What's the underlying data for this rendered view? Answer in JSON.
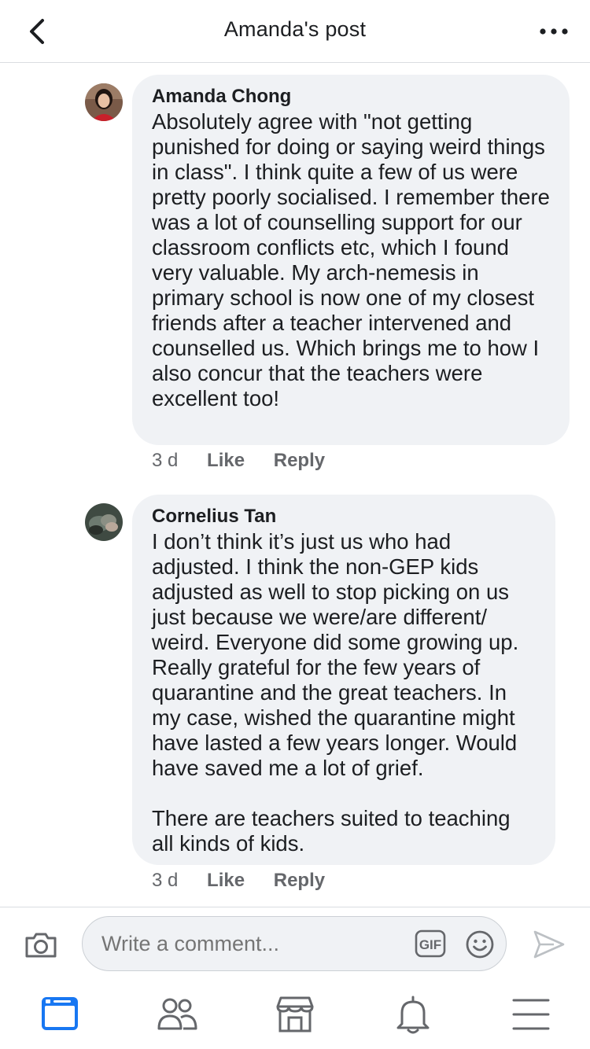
{
  "header": {
    "title": "Amanda's post",
    "back_icon": "chevron-left-icon",
    "more_icon": "more-horizontal-icon"
  },
  "comments": [
    {
      "author": "Amanda Chong",
      "text": "Absolutely agree with \"not getting punished for doing or saying weird things in class\". I think quite a few of us were pretty poorly socialised. I remember there was a lot of counselling support for our classroom conflicts etc, which I found very valuable. My arch-nemesis in primary school is now one of my closest friends after a teacher intervened and counselled us. Which brings me to how I also concur that the teachers were excellent too!",
      "time": "3 d",
      "like_label": "Like",
      "reply_label": "Reply"
    },
    {
      "author": "Cornelius Tan",
      "text": "I don’t think it’s just us who had adjusted. I think the non-GEP kids adjusted as well to stop picking on us just because we were/are different/ weird. Everyone did some growing up. Really grateful for the few years of quarantine and the great teachers. In my case, wished the quarantine might have lasted a few years longer. Would have saved me a lot of grief.\n\nThere are teachers suited to teaching all kinds of kids.",
      "time": "3 d",
      "like_label": "Like",
      "reply_label": "Reply"
    }
  ],
  "composer": {
    "placeholder": "Write a comment...",
    "gif_label": "GIF",
    "camera_icon": "camera-icon",
    "emoji_icon": "smiley-icon",
    "send_icon": "send-icon"
  },
  "tabbar": {
    "tabs": [
      "news-feed-icon",
      "friends-icon",
      "marketplace-icon",
      "notifications-icon",
      "menu-icon"
    ],
    "active_color": "#1877f2",
    "inactive_color": "#65676b"
  }
}
